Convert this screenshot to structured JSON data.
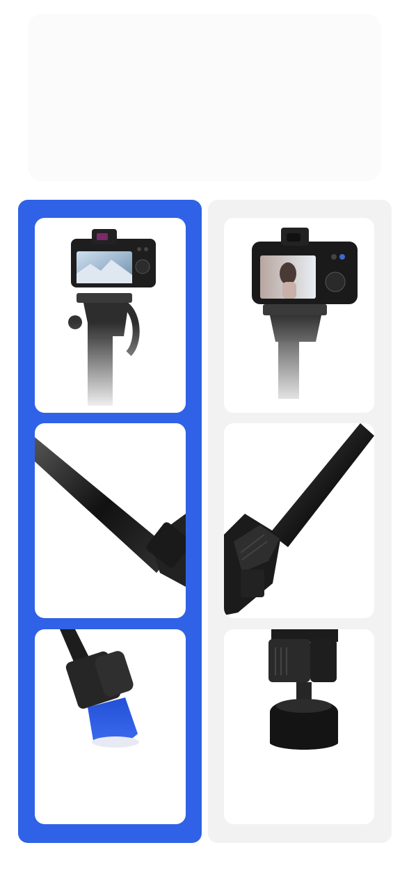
{
  "comparison": {
    "highlighted_option": "left",
    "left_column": {
      "panels": [
        {
          "subject": "camera-on-pan-head"
        },
        {
          "subject": "leg-tube-clamp"
        },
        {
          "subject": "rubber-foot"
        }
      ]
    },
    "right_column": {
      "panels": [
        {
          "subject": "dslr-on-pan-head"
        },
        {
          "subject": "flip-lock-clamp"
        },
        {
          "subject": "round-foot"
        }
      ]
    }
  },
  "colors": {
    "accent": "#2f62e6",
    "right_column_bg": "#f2f2f2",
    "panel_bg": "#ffffff"
  }
}
